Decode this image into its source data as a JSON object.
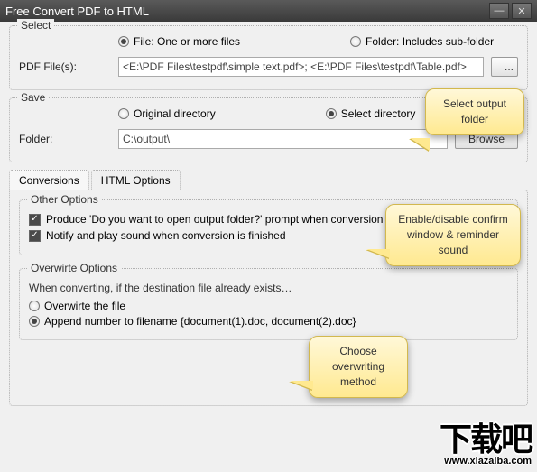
{
  "window": {
    "title": "Free Convert PDF to HTML"
  },
  "select": {
    "legend": "Select",
    "file_radio": "File:  One or more files",
    "folder_radio": "Folder: Includes sub-folder",
    "pdf_label": "PDF File(s):",
    "pdf_value": "<E:\\PDF Files\\testpdf\\simple text.pdf>; <E:\\PDF Files\\testpdf\\Table.pdf>",
    "dots": "..."
  },
  "save": {
    "legend": "Save",
    "orig_radio": "Original directory",
    "select_radio": "Select directory",
    "folder_label": "Folder:",
    "folder_value": "C:\\output\\",
    "browse": "Browse"
  },
  "tabs": {
    "conversions": "Conversions",
    "html": "HTML Options"
  },
  "other": {
    "legend": "Other Options",
    "prompt": "Produce 'Do you want to open output folder?' prompt when conversion is finished",
    "notify": "Notify and play sound when conversion is finished"
  },
  "overwrite": {
    "legend": "Overwirte Options",
    "desc": "When converting, if the destination file already exists…",
    "opt1": "Overwirte the file",
    "opt2": "Append number to filename  {document(1).doc, document(2).doc}"
  },
  "callouts": {
    "c1": "Select output folder",
    "c2": "Enable/disable confirm window & reminder sound",
    "c3": "Choose overwriting method"
  },
  "watermark": {
    "text": "下载吧",
    "url": "www.xiazaiba.com"
  }
}
